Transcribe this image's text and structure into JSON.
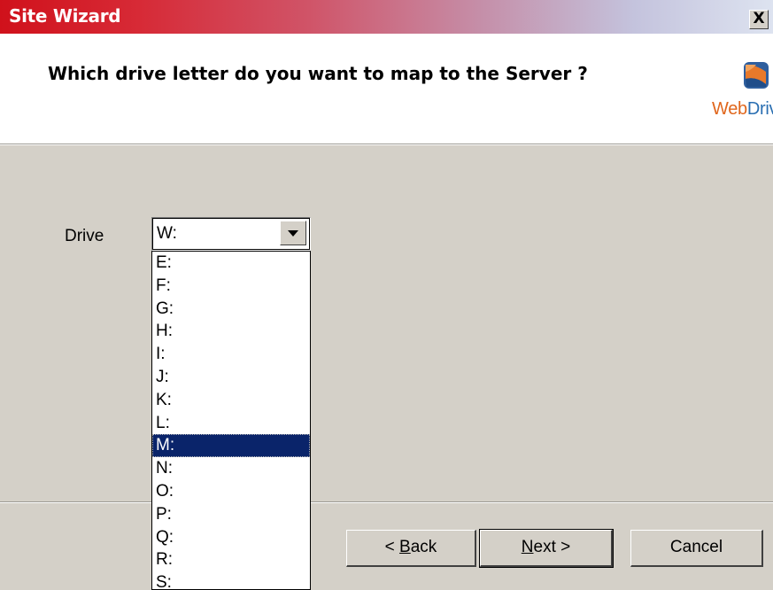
{
  "window": {
    "title": "Site Wizard",
    "close_label": "X"
  },
  "header": {
    "question": "Which drive letter do you want to map to the Server ?",
    "logo": {
      "text_web": "Web",
      "text_drive": "Drive",
      "icon": "webdrive-logo-icon"
    }
  },
  "form": {
    "drive_label": "Drive",
    "drive_value": "W:",
    "options": [
      "E:",
      "F:",
      "G:",
      "H:",
      "I:",
      "J:",
      "K:",
      "L:",
      "M:",
      "N:",
      "O:",
      "P:",
      "Q:",
      "R:",
      "S:"
    ],
    "highlighted": "M:"
  },
  "buttons": {
    "back_prefix": "< ",
    "back_accel": "B",
    "back_rest": "ack",
    "next_accel": "N",
    "next_rest": "ext >",
    "cancel": "Cancel"
  },
  "colors": {
    "title_gradient_start": "#d0111b",
    "title_gradient_end": "#dde3f0",
    "selection": "#0a246a",
    "dialog_face": "#d4d0c8"
  }
}
